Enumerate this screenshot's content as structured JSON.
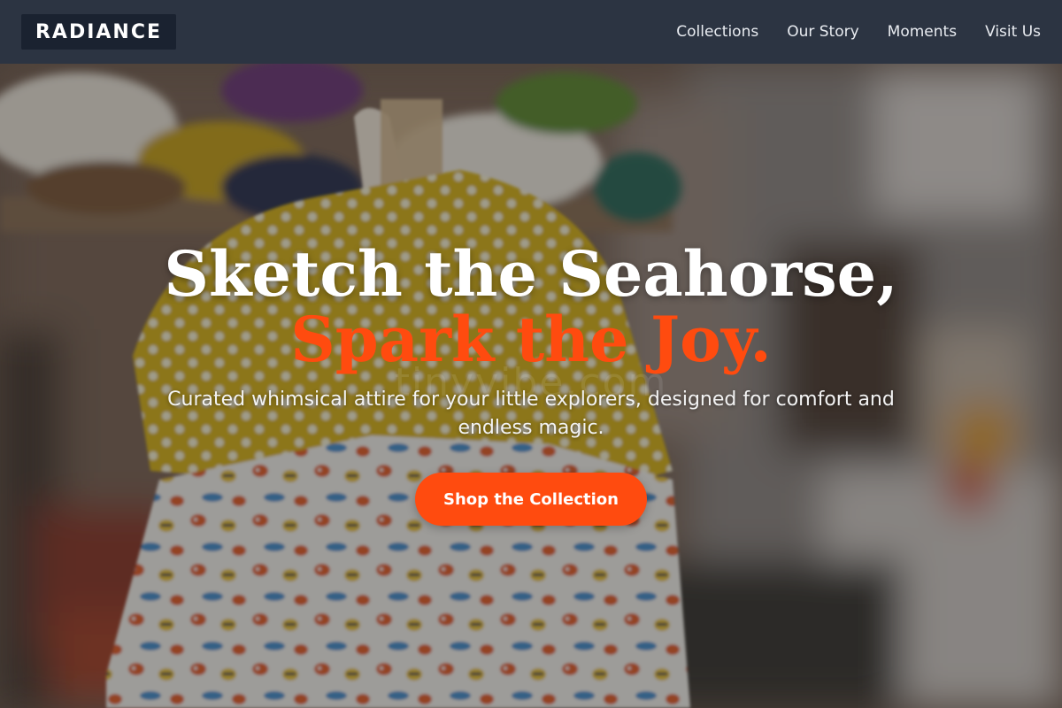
{
  "header": {
    "logo": "RADIANCE",
    "nav": [
      {
        "label": "Collections"
      },
      {
        "label": "Our Story"
      },
      {
        "label": "Moments"
      },
      {
        "label": "Visit Us"
      }
    ]
  },
  "hero": {
    "headline_line1": "Sketch the Seahorse,",
    "headline_line2": "Spark the Joy.",
    "subtitle": "Curated whimsical attire for your little explorers, designed for comfort and endless magic.",
    "cta_label": "Shop the Collection",
    "watermark": "tinyvibe.com"
  },
  "colors": {
    "header_bg": "#2c3442",
    "logo_bg": "#1a2230",
    "accent": "#ff4b0f",
    "headline_text": "#ffffff"
  },
  "icons": {
    "background": "baby-clothes-store-photo"
  }
}
